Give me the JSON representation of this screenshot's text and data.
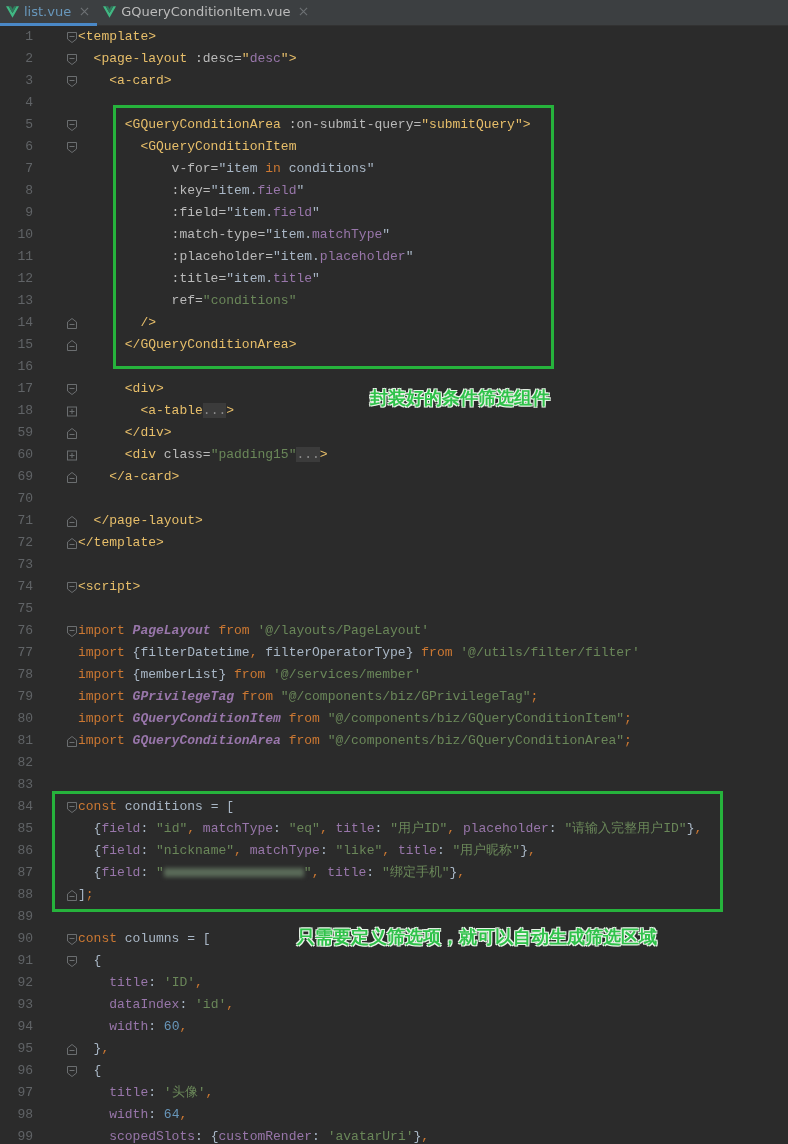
{
  "tabs": [
    {
      "label": "list.vue",
      "selected": true,
      "modified": true
    },
    {
      "label": "GQueryConditionItem.vue",
      "selected": false,
      "modified": false
    }
  ],
  "editor": {
    "segments": [
      {
        "lines": [
          {
            "number": "1",
            "kind": "opener",
            "tokens": [
              {
                "kind": "tag",
                "text": "<template>"
              }
            ]
          },
          {
            "number": "2",
            "kind": "opener",
            "tokens": [
              {
                "kind": "tag",
                "text": "  <page-layout"
              },
              {
                "kind": "attr",
                "text": " :desc="
              },
              {
                "kind": "tag",
                "text": "\""
              },
              {
                "kind": "prop",
                "text": "desc"
              },
              {
                "kind": "tag",
                "text": "\">"
              }
            ]
          },
          {
            "number": "3",
            "kind": "opener",
            "tokens": [
              {
                "kind": "tag",
                "text": "    <a-card>"
              }
            ]
          },
          {
            "number": "4",
            "kind": "plain"
          }
        ]
      },
      {
        "annotation": {
          "caption": "封装好的条件筛选组件"
        },
        "lines": [
          {
            "number": "5",
            "kind": "opener",
            "tokens": [
              {
                "kind": "tag",
                "text": "      <GQueryConditionArea"
              },
              {
                "kind": "attr",
                "text": " :on-submit-query="
              },
              {
                "kind": "tag",
                "text": "\"submitQuery\">"
              }
            ]
          },
          {
            "number": "6",
            "kind": "opener",
            "tokens": [
              {
                "kind": "tag",
                "text": "        <GQueryConditionItem"
              }
            ]
          },
          {
            "number": "7",
            "kind": "plain",
            "tokens": [
              {
                "kind": "attr",
                "text": "            v-for="
              },
              {
                "kind": "plain",
                "text": "\"item "
              },
              {
                "kind": "kw",
                "text": "in"
              },
              {
                "kind": "plain",
                "text": " conditions\""
              }
            ]
          },
          {
            "number": "8",
            "kind": "plain",
            "tokens": [
              {
                "kind": "attr",
                "text": "            :key="
              },
              {
                "kind": "plain",
                "text": "\"item."
              },
              {
                "kind": "prop",
                "text": "field"
              },
              {
                "kind": "plain",
                "text": "\""
              }
            ]
          },
          {
            "number": "9",
            "kind": "plain",
            "tokens": [
              {
                "kind": "attr",
                "text": "            :field="
              },
              {
                "kind": "plain",
                "text": "\"item."
              },
              {
                "kind": "prop",
                "text": "field"
              },
              {
                "kind": "plain",
                "text": "\""
              }
            ]
          },
          {
            "number": "10",
            "kind": "plain",
            "tokens": [
              {
                "kind": "attr",
                "text": "            :match-type="
              },
              {
                "kind": "plain",
                "text": "\"item."
              },
              {
                "kind": "prop",
                "text": "matchType"
              },
              {
                "kind": "plain",
                "text": "\""
              }
            ]
          },
          {
            "number": "11",
            "kind": "plain",
            "tokens": [
              {
                "kind": "attr",
                "text": "            :placeholder="
              },
              {
                "kind": "plain",
                "text": "\"item."
              },
              {
                "kind": "prop",
                "text": "placeholder"
              },
              {
                "kind": "plain",
                "text": "\""
              }
            ]
          },
          {
            "number": "12",
            "kind": "plain",
            "tokens": [
              {
                "kind": "attr",
                "text": "            :title="
              },
              {
                "kind": "plain",
                "text": "\"item."
              },
              {
                "kind": "prop",
                "text": "title"
              },
              {
                "kind": "plain",
                "text": "\""
              }
            ]
          },
          {
            "number": "13",
            "kind": "plain",
            "tokens": [
              {
                "kind": "attr",
                "text": "            ref="
              },
              {
                "kind": "str",
                "text": "\"conditions\""
              }
            ]
          },
          {
            "number": "14",
            "kind": "closer",
            "tokens": [
              {
                "kind": "tag",
                "text": "        />"
              }
            ]
          },
          {
            "number": "15",
            "kind": "closer",
            "tokens": [
              {
                "kind": "tag",
                "text": "      </GQueryConditionArea>"
              }
            ]
          }
        ]
      },
      {
        "lines": [
          {
            "number": "16",
            "kind": "plain"
          },
          {
            "number": "17",
            "kind": "opener",
            "tokens": [
              {
                "kind": "tag",
                "text": "      <div>"
              }
            ]
          },
          {
            "number": "18",
            "kind": "collapsed",
            "tokens": [
              {
                "kind": "tag",
                "text": "        <a-table"
              },
              {
                "kind": "folded",
                "text": "..."
              },
              {
                "kind": "tag",
                "text": ">"
              }
            ]
          },
          {
            "number": "59",
            "kind": "closer",
            "tokens": [
              {
                "kind": "tag",
                "text": "      </div>"
              }
            ]
          },
          {
            "number": "60",
            "kind": "collapsed",
            "tokens": [
              {
                "kind": "tag",
                "text": "      <div"
              },
              {
                "kind": "attr",
                "text": " class="
              },
              {
                "kind": "str",
                "text": "\"padding15\""
              },
              {
                "kind": "folded",
                "text": "..."
              },
              {
                "kind": "tag",
                "text": ">"
              }
            ]
          },
          {
            "number": "69",
            "kind": "closer",
            "tokens": [
              {
                "kind": "tag",
                "text": "    </a-card>"
              }
            ]
          },
          {
            "number": "70",
            "kind": "plain"
          },
          {
            "number": "71",
            "kind": "closer",
            "tokens": [
              {
                "kind": "tag",
                "text": "  </page-layout>"
              }
            ]
          },
          {
            "number": "72",
            "kind": "closer",
            "tokens": [
              {
                "kind": "tag",
                "text": "</template>"
              }
            ]
          },
          {
            "number": "73",
            "kind": "plain"
          },
          {
            "number": "74",
            "kind": "opener",
            "tokens": [
              {
                "kind": "tag",
                "text": "<script>"
              }
            ]
          },
          {
            "number": "75",
            "kind": "plain"
          },
          {
            "number": "76",
            "kind": "opener",
            "tokens": [
              {
                "kind": "kw",
                "text": "import "
              },
              {
                "kind": "cls",
                "text": "PageLayout"
              },
              {
                "kind": "kw",
                "text": " from "
              },
              {
                "kind": "str",
                "text": "'@/layouts/PageLayout'"
              }
            ]
          },
          {
            "number": "77",
            "kind": "plain",
            "tokens": [
              {
                "kind": "kw",
                "text": "import "
              },
              {
                "kind": "plain",
                "text": "{filterDatetime"
              },
              {
                "kind": "kw",
                "text": ", "
              },
              {
                "kind": "plain",
                "text": "filterOperatorType}"
              },
              {
                "kind": "kw",
                "text": " from "
              },
              {
                "kind": "str",
                "text": "'@/utils/filter/filter'"
              }
            ]
          },
          {
            "number": "78",
            "kind": "plain",
            "tokens": [
              {
                "kind": "kw",
                "text": "import "
              },
              {
                "kind": "plain",
                "text": "{memberList}"
              },
              {
                "kind": "kw",
                "text": " from "
              },
              {
                "kind": "str",
                "text": "'@/services/member'"
              }
            ]
          },
          {
            "number": "79",
            "kind": "plain",
            "tokens": [
              {
                "kind": "kw",
                "text": "import "
              },
              {
                "kind": "cls",
                "text": "GPrivilegeTag"
              },
              {
                "kind": "kw",
                "text": " from "
              },
              {
                "kind": "str",
                "text": "\"@/components/biz/GPrivilegeTag\""
              },
              {
                "kind": "kw",
                "text": ";"
              }
            ]
          },
          {
            "number": "80",
            "kind": "plain",
            "tokens": [
              {
                "kind": "kw",
                "text": "import "
              },
              {
                "kind": "cls",
                "text": "GQueryConditionItem"
              },
              {
                "kind": "kw",
                "text": " from "
              },
              {
                "kind": "str",
                "text": "\"@/components/biz/GQueryConditionItem\""
              },
              {
                "kind": "kw",
                "text": ";"
              }
            ]
          },
          {
            "number": "81",
            "kind": "closer",
            "tokens": [
              {
                "kind": "kw",
                "text": "import "
              },
              {
                "kind": "cls",
                "text": "GQueryConditionArea"
              },
              {
                "kind": "kw",
                "text": " from "
              },
              {
                "kind": "str",
                "text": "\"@/components/biz/GQueryConditionArea\""
              },
              {
                "kind": "kw",
                "text": ";"
              }
            ]
          },
          {
            "number": "82",
            "kind": "plain"
          },
          {
            "number": "83",
            "kind": "plain"
          }
        ]
      },
      {
        "annotation": {
          "caption": "只需要定义筛选项，就可以自动生成筛选区域"
        },
        "lines": [
          {
            "number": "84",
            "kind": "opener",
            "tokens": [
              {
                "kind": "kw",
                "text": "const "
              },
              {
                "kind": "plain",
                "text": "conditions = ["
              }
            ]
          },
          {
            "number": "85",
            "kind": "plain",
            "tokens": [
              {
                "kind": "plain",
                "text": "  {"
              },
              {
                "kind": "prop",
                "text": "field"
              },
              {
                "kind": "plain",
                "text": ": "
              },
              {
                "kind": "str",
                "text": "\"id\""
              },
              {
                "kind": "kw",
                "text": ", "
              },
              {
                "kind": "prop",
                "text": "matchType"
              },
              {
                "kind": "plain",
                "text": ": "
              },
              {
                "kind": "str",
                "text": "\"eq\""
              },
              {
                "kind": "kw",
                "text": ", "
              },
              {
                "kind": "prop",
                "text": "title"
              },
              {
                "kind": "plain",
                "text": ": "
              },
              {
                "kind": "str",
                "text": "\"用户ID\""
              },
              {
                "kind": "kw",
                "text": ", "
              },
              {
                "kind": "prop",
                "text": "placeholder"
              },
              {
                "kind": "plain",
                "text": ": "
              },
              {
                "kind": "str",
                "text": "\"请输入完整用户ID\""
              },
              {
                "kind": "plain",
                "text": "}"
              },
              {
                "kind": "kw",
                "text": ","
              }
            ]
          },
          {
            "number": "86",
            "kind": "plain",
            "tokens": [
              {
                "kind": "plain",
                "text": "  {"
              },
              {
                "kind": "prop",
                "text": "field"
              },
              {
                "kind": "plain",
                "text": ": "
              },
              {
                "kind": "str",
                "text": "\"nickname\""
              },
              {
                "kind": "kw",
                "text": ", "
              },
              {
                "kind": "prop",
                "text": "matchType"
              },
              {
                "kind": "plain",
                "text": ": "
              },
              {
                "kind": "str",
                "text": "\"like\""
              },
              {
                "kind": "kw",
                "text": ", "
              },
              {
                "kind": "prop",
                "text": "title"
              },
              {
                "kind": "plain",
                "text": ": "
              },
              {
                "kind": "str",
                "text": "\"用户昵称\""
              },
              {
                "kind": "plain",
                "text": "}"
              },
              {
                "kind": "kw",
                "text": ","
              }
            ]
          },
          {
            "number": "87",
            "kind": "plain",
            "tokens": [
              {
                "kind": "plain",
                "text": "  {"
              },
              {
                "kind": "prop",
                "text": "field"
              },
              {
                "kind": "plain",
                "text": ": "
              },
              {
                "kind": "str",
                "text": "\""
              },
              {
                "kind": "redacted"
              },
              {
                "kind": "str",
                "text": "\""
              },
              {
                "kind": "kw",
                "text": ", "
              },
              {
                "kind": "prop",
                "text": "title"
              },
              {
                "kind": "plain",
                "text": ": "
              },
              {
                "kind": "str",
                "text": "\"绑定手机\""
              },
              {
                "kind": "plain",
                "text": "}"
              },
              {
                "kind": "kw",
                "text": ","
              }
            ]
          },
          {
            "number": "88",
            "kind": "closer",
            "tokens": [
              {
                "kind": "plain",
                "text": "]"
              },
              {
                "kind": "kw",
                "text": ";"
              }
            ]
          }
        ]
      },
      {
        "lines": [
          {
            "number": "89",
            "kind": "plain"
          },
          {
            "number": "90",
            "kind": "opener",
            "tokens": [
              {
                "kind": "kw",
                "text": "const "
              },
              {
                "kind": "plain",
                "text": "columns = ["
              }
            ]
          },
          {
            "number": "91",
            "kind": "opener",
            "tokens": [
              {
                "kind": "plain",
                "text": "  {"
              }
            ]
          },
          {
            "number": "92",
            "kind": "plain",
            "tokens": [
              {
                "kind": "prop",
                "text": "    title"
              },
              {
                "kind": "plain",
                "text": ": "
              },
              {
                "kind": "str",
                "text": "'ID'"
              },
              {
                "kind": "kw",
                "text": ","
              }
            ]
          },
          {
            "number": "93",
            "kind": "plain",
            "tokens": [
              {
                "kind": "prop",
                "text": "    dataIndex"
              },
              {
                "kind": "plain",
                "text": ": "
              },
              {
                "kind": "str",
                "text": "'id'"
              },
              {
                "kind": "kw",
                "text": ","
              }
            ]
          },
          {
            "number": "94",
            "kind": "plain",
            "tokens": [
              {
                "kind": "prop",
                "text": "    width"
              },
              {
                "kind": "plain",
                "text": ": "
              },
              {
                "kind": "num",
                "text": "60"
              },
              {
                "kind": "kw",
                "text": ","
              }
            ]
          },
          {
            "number": "95",
            "kind": "closer",
            "tokens": [
              {
                "kind": "plain",
                "text": "  }"
              },
              {
                "kind": "kw",
                "text": ","
              }
            ]
          },
          {
            "number": "96",
            "kind": "opener",
            "tokens": [
              {
                "kind": "plain",
                "text": "  {"
              }
            ]
          },
          {
            "number": "97",
            "kind": "plain",
            "tokens": [
              {
                "kind": "prop",
                "text": "    title"
              },
              {
                "kind": "plain",
                "text": ": "
              },
              {
                "kind": "str",
                "text": "'头像'"
              },
              {
                "kind": "kw",
                "text": ","
              }
            ]
          },
          {
            "number": "98",
            "kind": "plain",
            "tokens": [
              {
                "kind": "prop",
                "text": "    width"
              },
              {
                "kind": "plain",
                "text": ": "
              },
              {
                "kind": "num",
                "text": "64"
              },
              {
                "kind": "kw",
                "text": ","
              }
            ]
          },
          {
            "number": "99",
            "kind": "plain",
            "tokens": [
              {
                "kind": "prop",
                "text": "    scopedSlots"
              },
              {
                "kind": "plain",
                "text": ": {"
              },
              {
                "kind": "prop",
                "text": "customRender"
              },
              {
                "kind": "plain",
                "text": ": "
              },
              {
                "kind": "str",
                "text": "'avatarUri'"
              },
              {
                "kind": "plain",
                "text": "}"
              },
              {
                "kind": "kw",
                "text": ","
              }
            ]
          }
        ]
      }
    ]
  }
}
